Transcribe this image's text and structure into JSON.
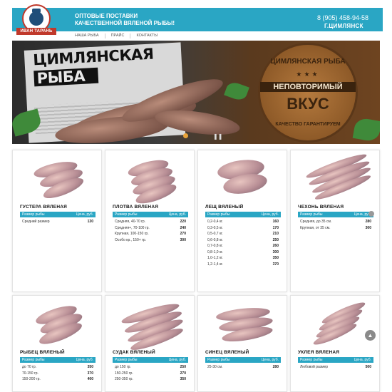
{
  "header": {
    "logo_text": "ИВАН ТАРАНЬ",
    "tagline_line1": "ОПТОВЫЕ ПОСТАВКИ",
    "tagline_line2": "КАЧЕСТВЕННОЙ ВЯЛЕНОЙ РЫБЫ!",
    "phone": "8 (905) 458-94-58",
    "city": "Г.ЦИМЛЯНСК",
    "brand_color": "#2aa6c4"
  },
  "nav": {
    "items": [
      {
        "label": "НАША РЫБА"
      },
      {
        "label": "ПРАЙС"
      },
      {
        "label": "КОНТАКТЫ"
      }
    ]
  },
  "banner": {
    "title_line1": "ЦИМЛЯНСКАЯ",
    "title_line2": "РЫБА",
    "stamp_top": "ЦИМЛЯНСКАЯ РЫБА",
    "stamp_mid": "НЕПОВТОРИМЫЙ",
    "stamp_big": "ВКУС",
    "stamp_bottom": "КАЧЕСТВО ГАРАНТИРУЕМ",
    "stamp_stars": "★★★",
    "slide_count": 2,
    "active_slide": 1,
    "dot_active_color": "#e8a33b",
    "dot_inactive_color": "#bbbbbb"
  },
  "table_header": {
    "size": "Размер рыбы",
    "price": "Цена, руб."
  },
  "products": [
    {
      "name": "ГУСТЕРА ВЯЛЕНАЯ",
      "rows": [
        {
          "size": "Средний размер",
          "price": "130"
        }
      ]
    },
    {
      "name": "ПЛОТВА ВЯЛЕНАЯ",
      "rows": [
        {
          "size": "Средняя, 40-70 гр.",
          "price": "220"
        },
        {
          "size": "Средняя+, 70-100 гр.",
          "price": "240"
        },
        {
          "size": "Крупная, 100-150 гр.",
          "price": "270"
        },
        {
          "size": "Особо кр., 150+ гр.",
          "price": "300"
        }
      ]
    },
    {
      "name": "ЛЕЩ ВЯЛЕНЫЙ",
      "rows": [
        {
          "size": "0,2-0,4 кг.",
          "price": "160"
        },
        {
          "size": "0,3-0,5 кг.",
          "price": "170"
        },
        {
          "size": "0,5-0,7 кг.",
          "price": "210"
        },
        {
          "size": "0,6-0,8 кг.",
          "price": "250"
        },
        {
          "size": "0,7-0,8 кг.",
          "price": "260"
        },
        {
          "size": "0,8-1,0 кг.",
          "price": "300"
        },
        {
          "size": "1,0-1,2 кг.",
          "price": "350"
        },
        {
          "size": "1,2-1,4 кг.",
          "price": "370"
        }
      ]
    },
    {
      "name": "ЧЕХОНЬ ВЯЛЕНАЯ",
      "rows": [
        {
          "size": "Средняя, до 35 см.",
          "price": "280"
        },
        {
          "size": "Крупная, от 35 см.",
          "price": "300"
        }
      ]
    },
    {
      "name": "РЫБЕЦ ВЯЛЕНЫЙ",
      "rows": [
        {
          "size": "до 70 гр.",
          "price": "350"
        },
        {
          "size": "70-150 гр.",
          "price": "370"
        },
        {
          "size": "150-200 гр.",
          "price": "400"
        }
      ]
    },
    {
      "name": "СУДАК ВЯЛЕНЫЙ",
      "rows": [
        {
          "size": "до 150 гр.",
          "price": "250"
        },
        {
          "size": "150-250 гр.",
          "price": "270"
        },
        {
          "size": "250-350 гр.",
          "price": "350"
        }
      ]
    },
    {
      "name": "СИНЕЦ ВЯЛЕНЫЙ",
      "rows": [
        {
          "size": "25-30 см.",
          "price": "280"
        }
      ]
    },
    {
      "name": "УКЛЕЯ ВЯЛЕНАЯ",
      "rows": [
        {
          "size": "Любовой размер",
          "price": "500"
        }
      ]
    }
  ],
  "scroll_top_icon": "arrow-up-icon"
}
